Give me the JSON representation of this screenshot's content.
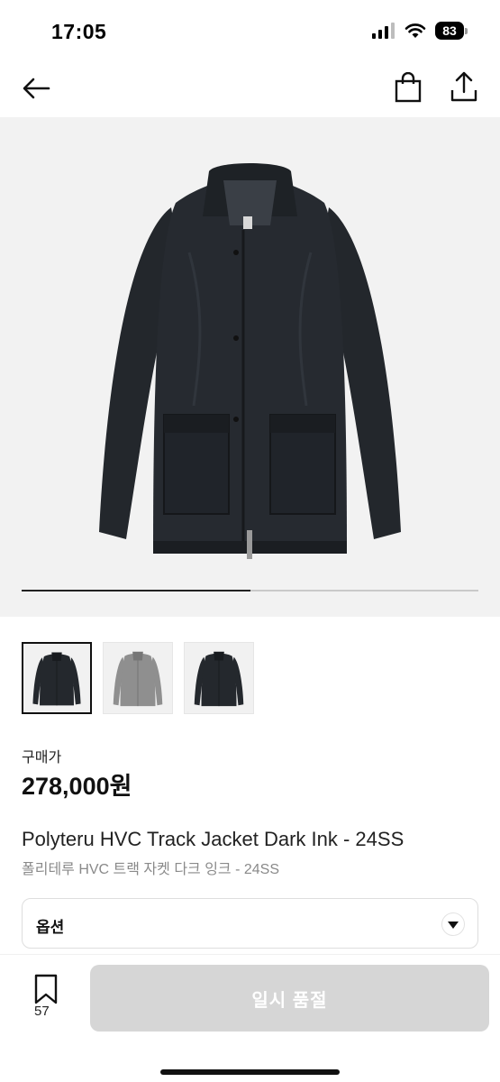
{
  "status_bar": {
    "time": "17:05",
    "battery": "83",
    "icons": [
      "signal-icon",
      "wifi-icon",
      "battery-icon"
    ]
  },
  "nav": {
    "back_icon": "arrow-left-icon",
    "bag_icon": "shopping-bag-icon",
    "share_icon": "share-icon"
  },
  "gallery": {
    "progress": 0.5,
    "thumbnails": [
      {
        "color": "dark",
        "selected": true
      },
      {
        "color": "grey",
        "selected": false
      },
      {
        "color": "dark",
        "selected": false
      }
    ]
  },
  "product": {
    "price_label": "구매가",
    "price": "278,000원",
    "title_en": "Polyteru HVC Track Jacket Dark Ink - 24SS",
    "title_ko": "폴리테루 HVC 트랙 자켓 다크 잉크 - 24SS"
  },
  "option": {
    "label": "옵션",
    "icon": "caret-down-icon"
  },
  "bottom_bar": {
    "bookmark_icon": "bookmark-icon",
    "bookmark_count": "57",
    "action_label": "일시 품절"
  },
  "colors": {
    "accent": "#111111",
    "disabled_button": "#d6d6d6",
    "muted_text": "#8a8a8a",
    "hero_bg": "#f2f2f2"
  }
}
